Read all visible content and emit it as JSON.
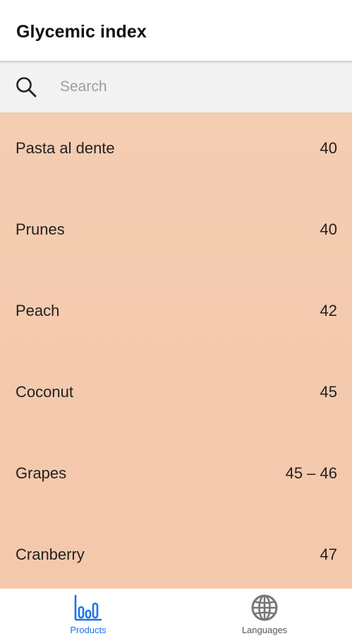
{
  "app_bar": {
    "title": "Glycemic index"
  },
  "search": {
    "placeholder": "Search",
    "icon": "search-icon"
  },
  "colors": {
    "list_background": "#f4cdb2",
    "active_tab": "#1a73e8",
    "inactive_tab": "#757575"
  },
  "products": [
    {
      "name": "Pasta al dente",
      "gi": "40"
    },
    {
      "name": "Prunes",
      "gi": "40"
    },
    {
      "name": "Peach",
      "gi": "42"
    },
    {
      "name": "Coconut",
      "gi": "45"
    },
    {
      "name": "Grapes",
      "gi": "45 – 46"
    },
    {
      "name": "Cranberry",
      "gi": "47"
    }
  ],
  "bottom_nav": {
    "tabs": [
      {
        "label": "Products",
        "icon": "bar-chart-icon",
        "active": true
      },
      {
        "label": "Languages",
        "icon": "globe-icon",
        "active": false
      }
    ]
  }
}
